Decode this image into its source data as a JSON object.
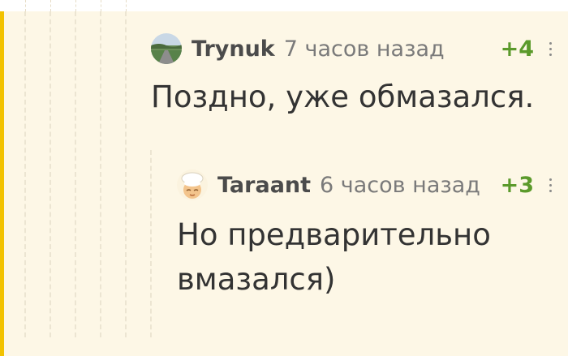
{
  "thread": {
    "comments": [
      {
        "author": "Trynuk",
        "time": "7 часов назад",
        "rating": "+4",
        "text": "Поздно, уже обмазался.",
        "avatar_icon": "landscape-road-icon"
      },
      {
        "author": "Taraant",
        "time": "6 часов назад",
        "rating": "+3",
        "text": "Но предварительно вмазался)",
        "avatar_icon": "chef-avatar-icon"
      }
    ],
    "colors": {
      "background": "#fdf7e6",
      "accent_bar": "#f2c200",
      "rating": "#5b9a2b",
      "username": "#4b4b4b",
      "time": "#7a7a7a"
    }
  }
}
